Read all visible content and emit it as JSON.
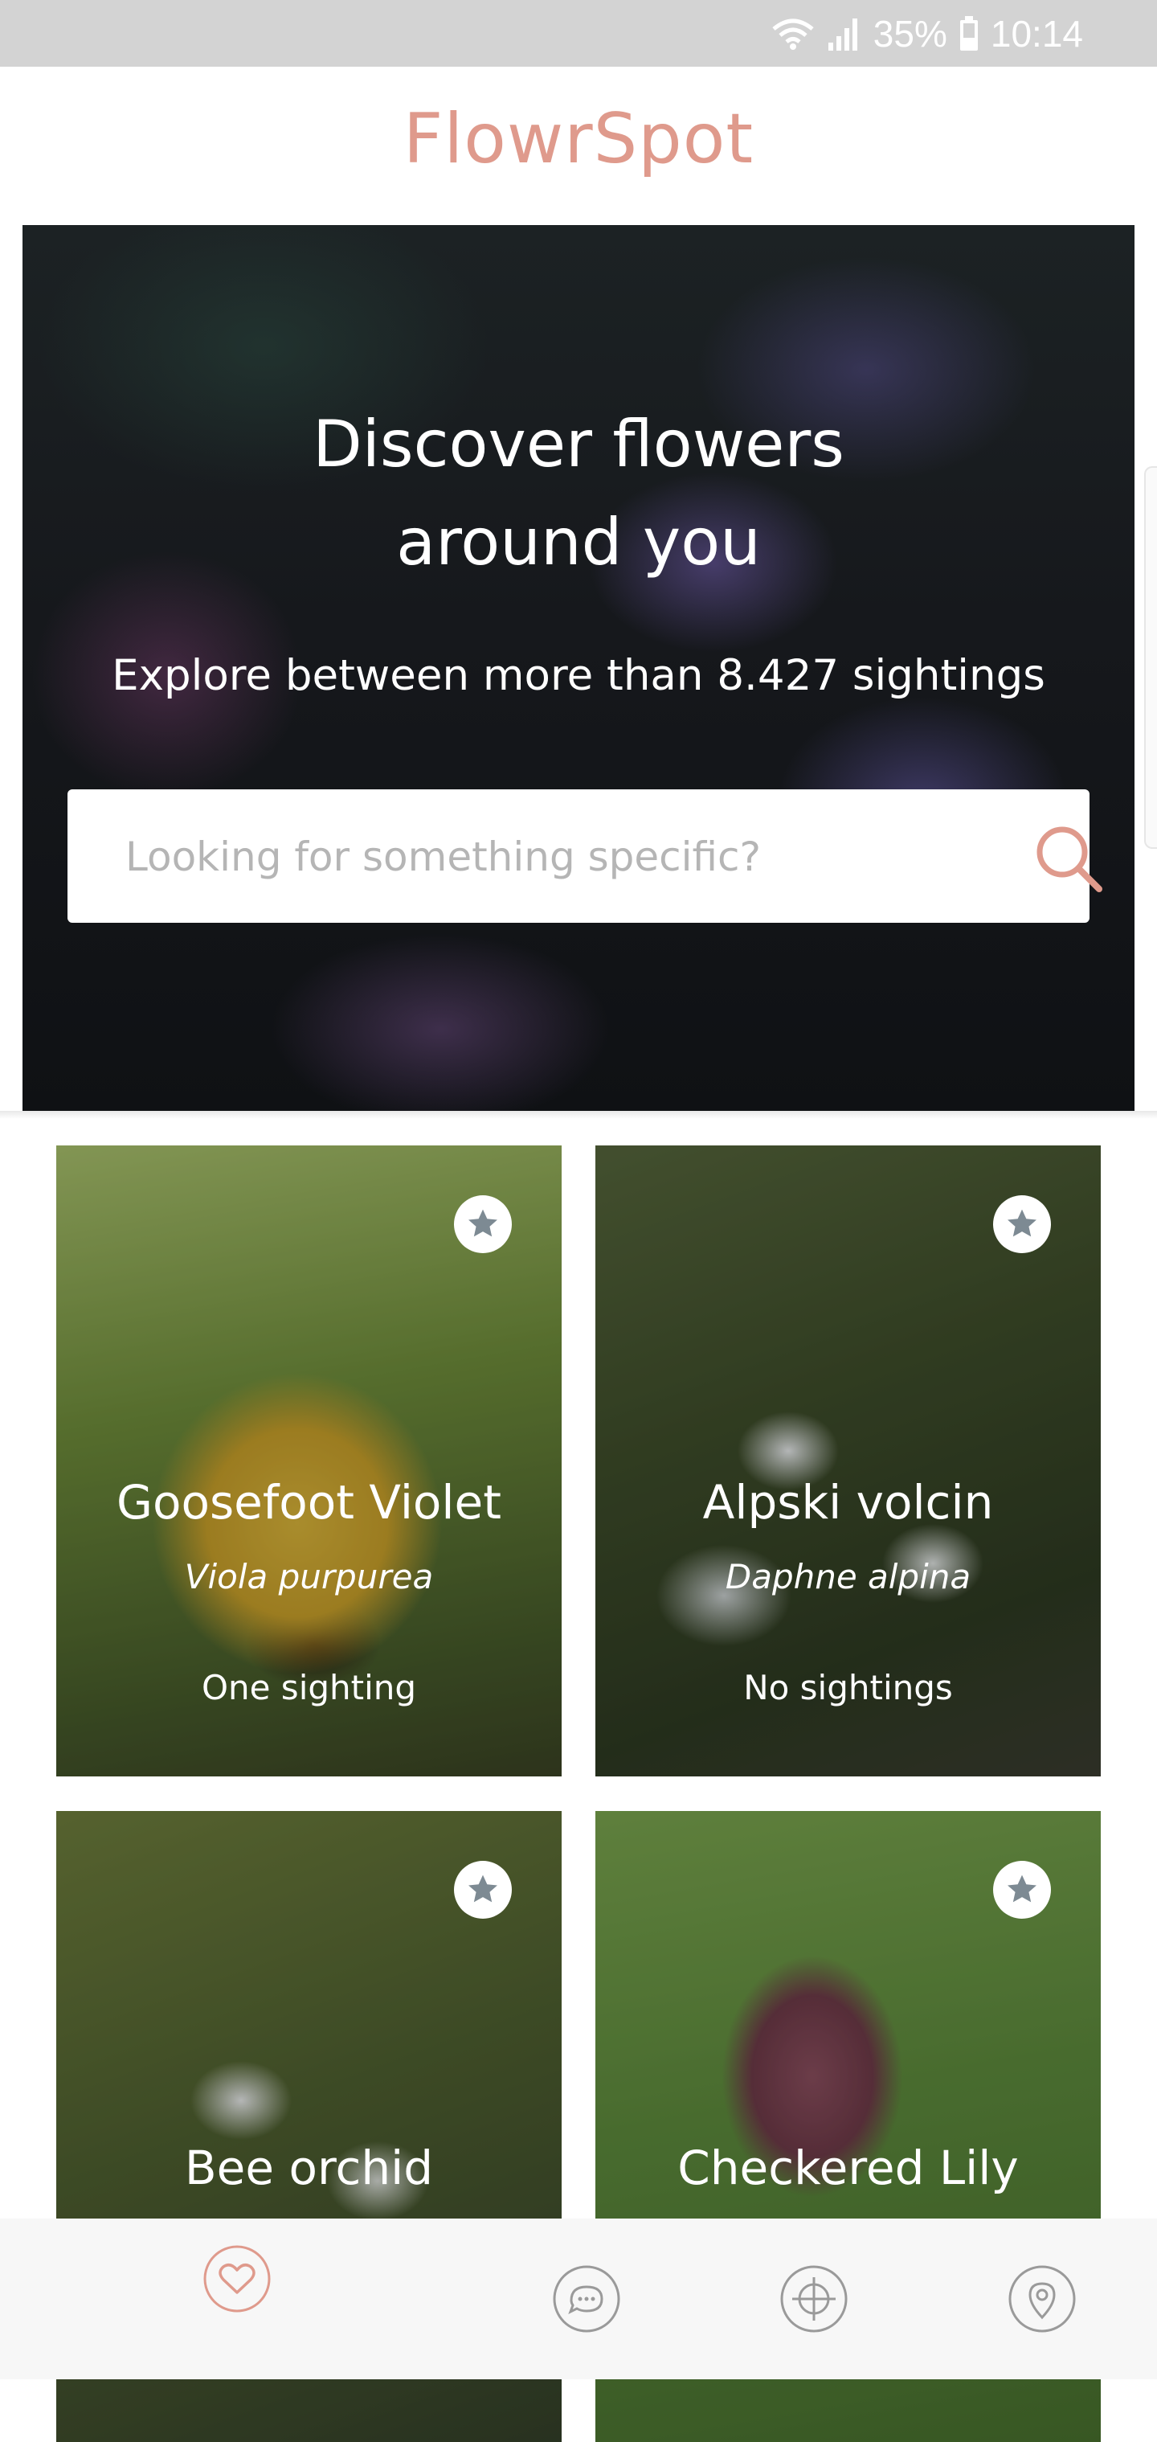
{
  "status_bar": {
    "battery": "35%",
    "time": "10:14"
  },
  "app": {
    "title": "FlowrSpot"
  },
  "hero": {
    "heading_line1": "Discover flowers",
    "heading_line2": "around you",
    "subtitle": "Explore between more than 8.427 sightings",
    "search_placeholder": "Looking for something specific?"
  },
  "flowers": [
    {
      "name": "Goosefoot Violet",
      "latin_name": "Viola purpurea",
      "sightings": "One sighting"
    },
    {
      "name": "Alpski volcin",
      "latin_name": "Daphne alpina",
      "sightings": "No sightings"
    },
    {
      "name": "Bee orchid"
    },
    {
      "name": "Checkered Lily"
    }
  ],
  "bottom_nav": {
    "items": [
      "heart-icon",
      "chat-bubble-icon",
      "crosshair-icon",
      "map-pin-icon"
    ],
    "active": "heart-icon"
  },
  "colors": {
    "accent": "#df9a8c",
    "status_bar": "#d3d3d3",
    "nav_icon": "#9a9a9a"
  }
}
